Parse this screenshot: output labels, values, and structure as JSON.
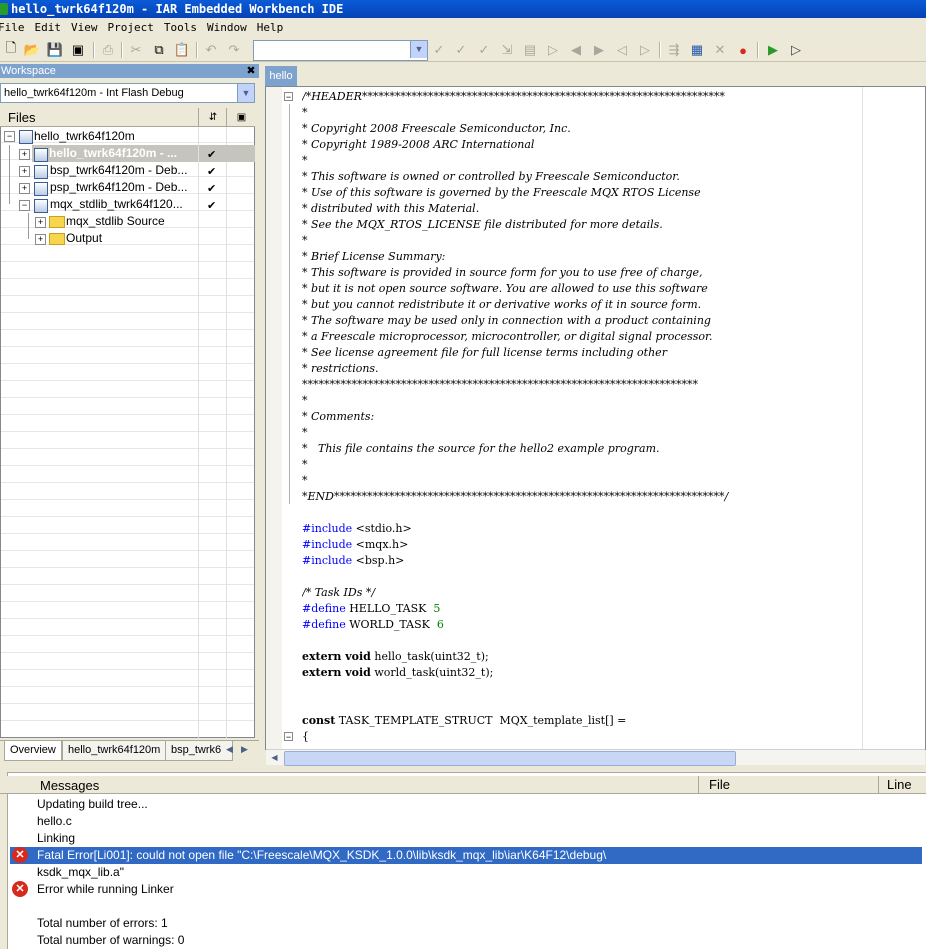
{
  "window": {
    "title": "hello_twrk64f120m - IAR Embedded Workbench IDE"
  },
  "menu": [
    "File",
    "Edit",
    "View",
    "Project",
    "Tools",
    "Window",
    "Help"
  ],
  "workspace": {
    "header": "Workspace",
    "config": "hello_twrk64f120m - Int Flash Debug",
    "files_header": "Files",
    "tree": [
      {
        "label": "hello_twrk64f120m"
      },
      {
        "label": "hello_twrk64f120m - ..."
      },
      {
        "label": "bsp_twrk64f120m - Deb..."
      },
      {
        "label": "psp_twrk64f120m - Deb..."
      },
      {
        "label": "mqx_stdlib_twrk64f120..."
      },
      {
        "label": "mqx_stdlib Source"
      },
      {
        "label": "Output"
      }
    ],
    "tabs": [
      "Overview",
      "hello_twrk64f120m",
      "bsp_twrk6"
    ]
  },
  "editor": {
    "tab": "hello"
  },
  "messages": {
    "headers": {
      "messages": "Messages",
      "file": "File",
      "line": "Line"
    },
    "lines": [
      "Updating build tree...",
      "hello.c",
      "Linking",
      "Fatal Error[Li001]: could not open file \"C:\\Freescale\\MQX_KSDK_1.0.0\\lib\\ksdk_mqx_lib\\iar\\K64F12\\debug\\",
      "ksdk_mqx_lib.a\"",
      "Error while running Linker",
      "",
      "Total number of errors: 1",
      "Total number of warnings: 0"
    ]
  }
}
